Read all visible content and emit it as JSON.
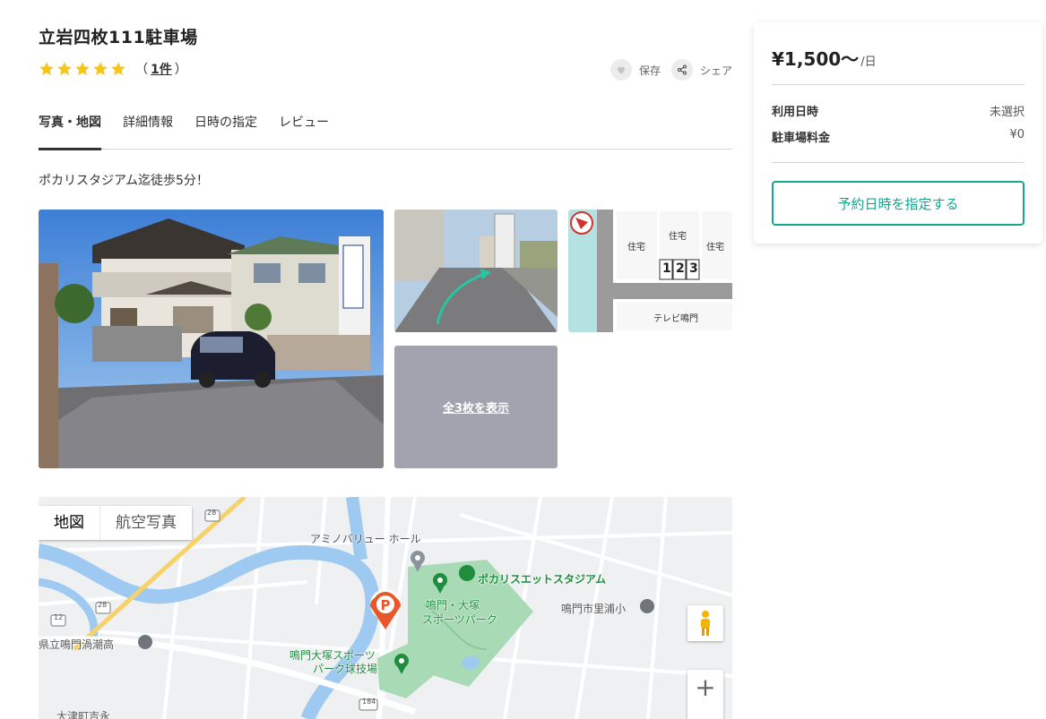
{
  "listing": {
    "title": "立岩四枚111駐車場",
    "rating_stars": 5,
    "review_open": "（",
    "review_count": "1件",
    "review_close": "）",
    "description": "ポカリスタジアム迄徒歩5分！"
  },
  "actions": {
    "save_label": "保存",
    "share_label": "シェア"
  },
  "tabs": [
    {
      "label": "写真・地図",
      "active": true
    },
    {
      "label": "詳細情報",
      "active": false
    },
    {
      "label": "日時の指定",
      "active": false
    },
    {
      "label": "レビュー",
      "active": false
    }
  ],
  "gallery": {
    "show_all_label": "全3枚を表示",
    "diagram": {
      "house_label": "住宅",
      "spaces": [
        "1",
        "2",
        "3"
      ],
      "street_label": "テレビ鳴門"
    }
  },
  "map": {
    "type_map_label": "地図",
    "type_satellite_label": "航空写真",
    "labels": {
      "hall": "アミノバリュー ホール",
      "stadium": "ポカリスエットスタジアム",
      "park_line1": "鳴門・大塚",
      "park_line2": "スポーツパーク",
      "school1": "鳴門市里浦小",
      "school2": "県立鳴門渦潮高",
      "ballpark_line1": "鳴門大塚スポーツ",
      "ballpark_line2": "パーク球技場",
      "town": "大津町吉永",
      "road_28a": "28",
      "road_28b": "28",
      "road_12": "12",
      "road_184": "184"
    }
  },
  "booking": {
    "price": "¥1,500〜",
    "price_unit": "/日",
    "date_label": "利用日時",
    "date_value": "未選択",
    "fee_label": "駐車場料金",
    "fee_value": "¥0",
    "reserve_button": "予約日時を指定する"
  },
  "colors": {
    "accent": "#17a58e",
    "star": "#f5c518",
    "park_green": "#a8dab5",
    "water": "#9ec9f0",
    "pin": "#e8562a"
  }
}
